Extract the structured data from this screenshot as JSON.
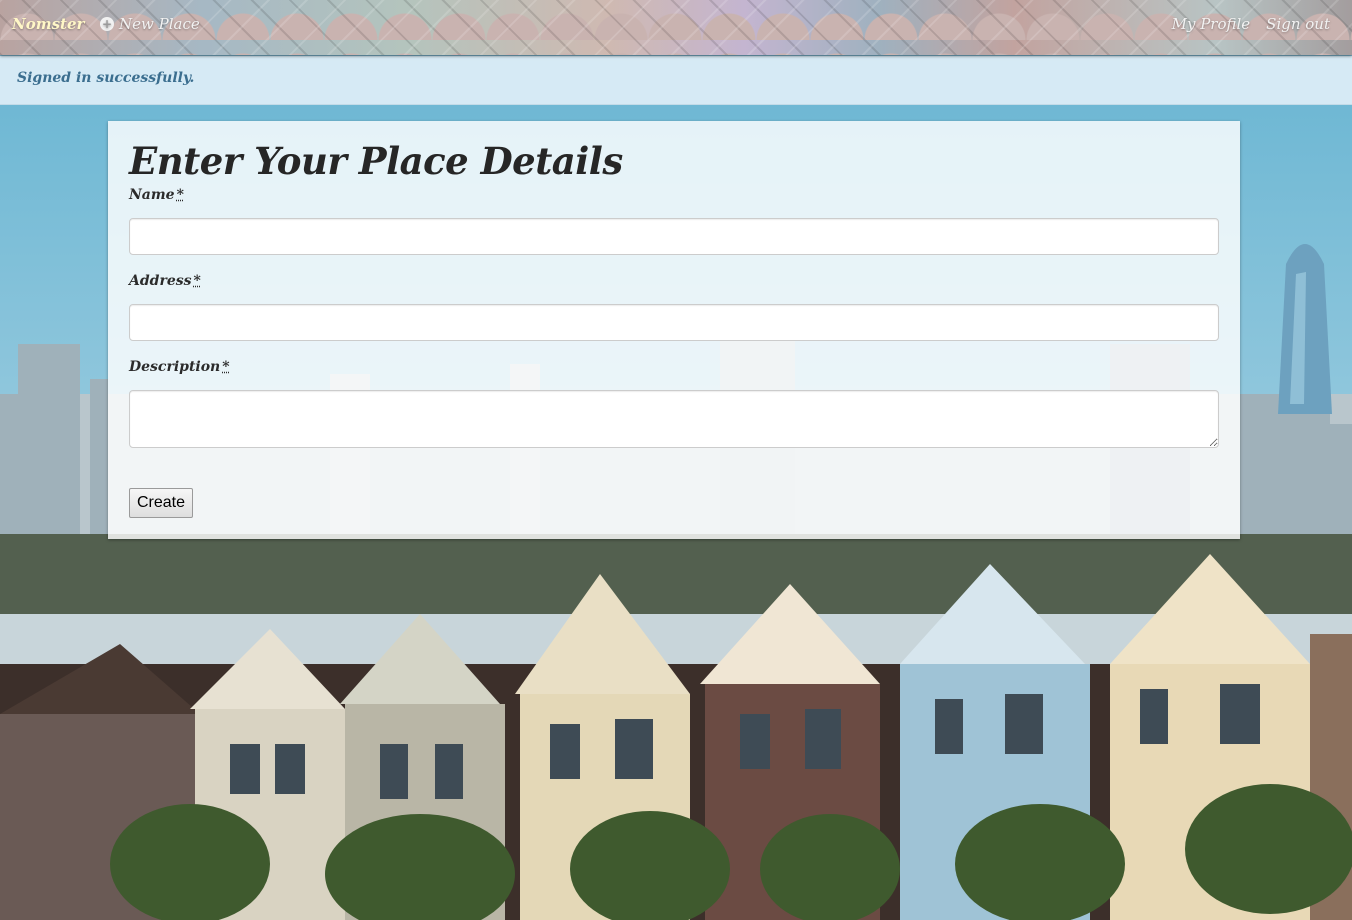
{
  "navbar": {
    "brand": "Nomster",
    "new_place": "New Place",
    "my_profile": "My Profile",
    "sign_out": "Sign out"
  },
  "flash": {
    "message": "Signed in successfully."
  },
  "form": {
    "heading": "Enter Your Place Details",
    "name_label": "Name",
    "address_label": "Address",
    "description_label": "Description",
    "required_mark": "*",
    "name_value": "",
    "address_value": "",
    "description_value": "",
    "submit_label": "Create"
  },
  "icons": {
    "new_place": "plus-circle-icon"
  },
  "colors": {
    "brand": "#fff7c7",
    "flash_bg": "#d6eaf5",
    "flash_text": "#3b6e8f",
    "sky": "#6fb8d4"
  }
}
